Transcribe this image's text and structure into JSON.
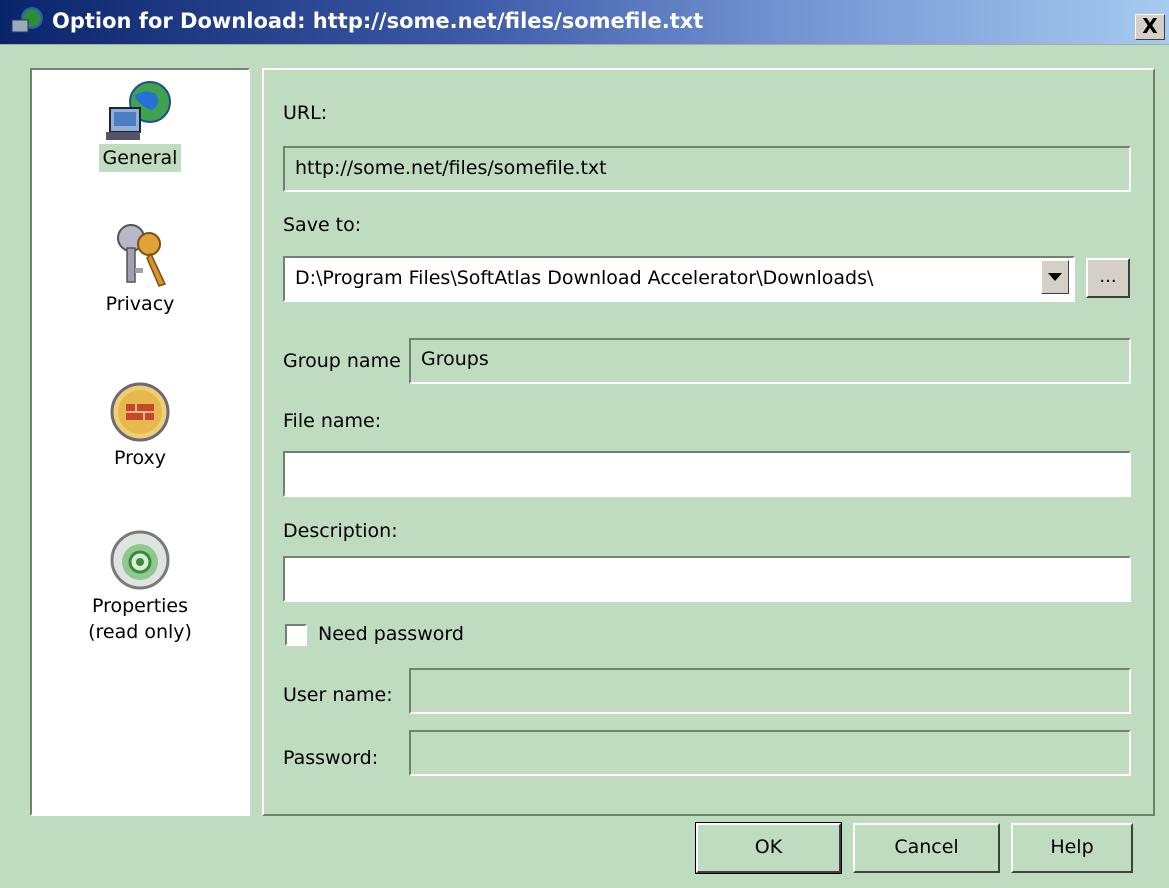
{
  "window": {
    "title": "Option for Download: http://some.net/files/somefile.txt",
    "close_label": "X"
  },
  "nav": {
    "items": [
      {
        "label": "General",
        "icon": "globe-computer-icon",
        "selected": true
      },
      {
        "label": "Privacy",
        "icon": "keys-icon",
        "selected": false
      },
      {
        "label": "Proxy",
        "icon": "firewall-icon",
        "selected": false
      },
      {
        "label": "Properties\n(read only)",
        "icon": "properties-disc-icon",
        "selected": false
      }
    ]
  },
  "form": {
    "url_label": "URL:",
    "url_value": "http://some.net/files/somefile.txt",
    "save_to_label": "Save to:",
    "save_to_value": "D:\\Program Files\\SoftAtlas Download Accelerator\\Downloads\\",
    "browse_label": "...",
    "group_name_label": "Group name",
    "group_name_value": "Groups",
    "file_name_label": "File name:",
    "file_name_value": "",
    "description_label": "Description:",
    "description_value": "",
    "need_password_label": "Need password",
    "need_password_checked": false,
    "user_name_label": "User name:",
    "user_name_value": "",
    "password_label": "Password:",
    "password_value": ""
  },
  "buttons": {
    "ok": "OK",
    "cancel": "Cancel",
    "help": "Help"
  }
}
